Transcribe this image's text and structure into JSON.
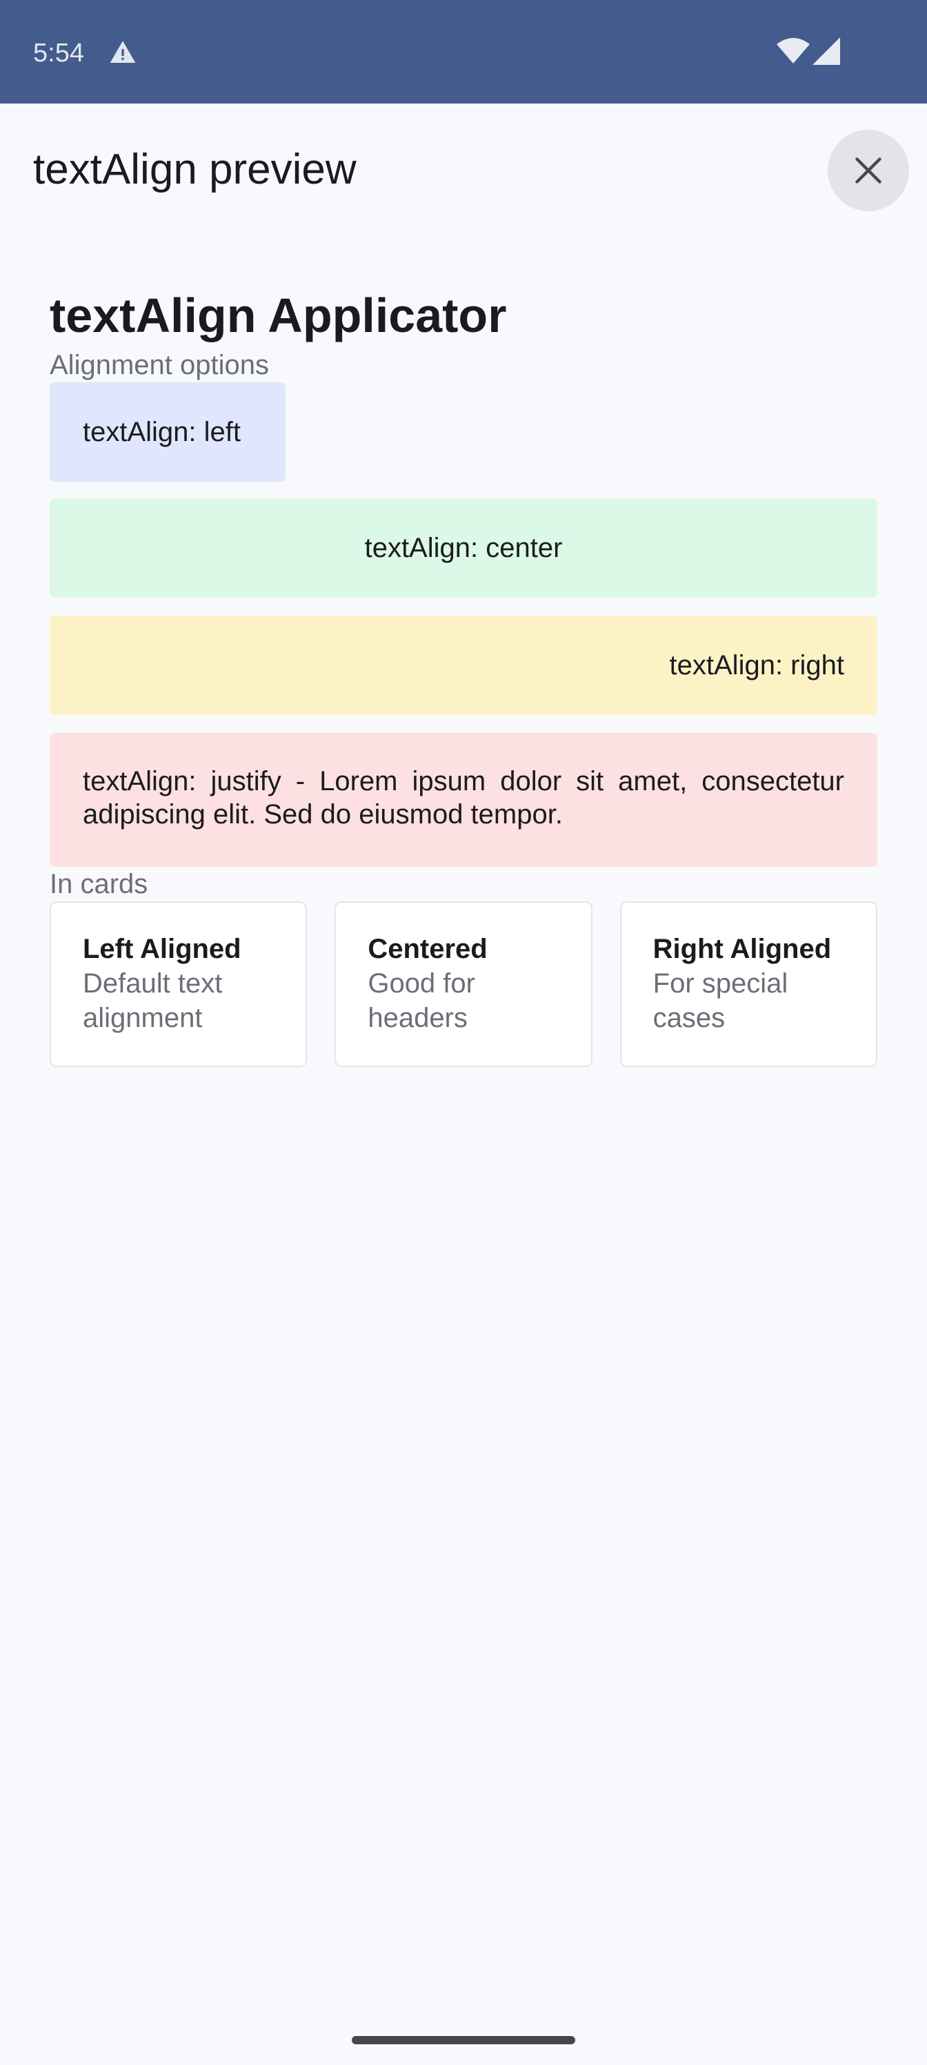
{
  "status_bar": {
    "time": "5:54",
    "icons": [
      "warning-icon",
      "wifi-icon",
      "signal-icon"
    ]
  },
  "app_bar": {
    "title": "textAlign preview",
    "close_icon": "close-icon"
  },
  "content": {
    "heading": "textAlign Applicator",
    "alignment_label": "Alignment options",
    "boxes": [
      {
        "label": "textAlign: left",
        "color": "#e0e6fd"
      },
      {
        "label": "textAlign: center",
        "color": "#dcf8e6"
      },
      {
        "label": "textAlign: right",
        "color": "#fdf2c6"
      },
      {
        "label": "textAlign: justify - Lorem ipsum dolor sit amet, consectetur adipiscing elit. Sed do eiusmod tempor.",
        "color": "#fde0e1"
      }
    ],
    "cards_label": "In cards",
    "cards": [
      {
        "title": "Left Aligned",
        "description": "Default text alignment"
      },
      {
        "title": "Centered",
        "description": "Good for headers"
      },
      {
        "title": "Right Aligned",
        "description": "For special cases"
      }
    ]
  },
  "colors": {
    "status_bar": "#445b8d",
    "background": "#f8f9fc",
    "close_button": "#e3e3e8"
  }
}
